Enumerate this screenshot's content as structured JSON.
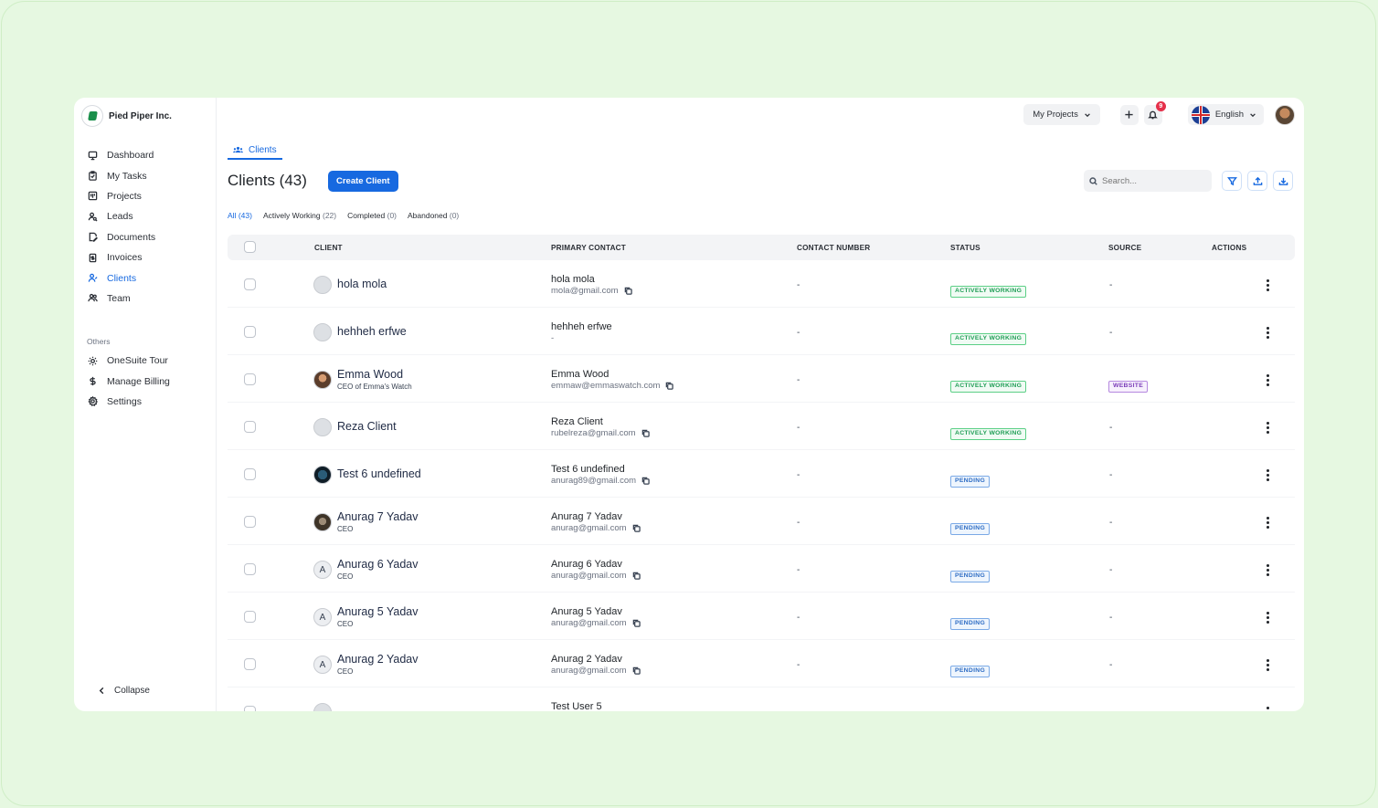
{
  "sidebar": {
    "brand_name": "Pied Piper Inc.",
    "nav": [
      {
        "label": "Dashboard",
        "icon": "monitor-icon"
      },
      {
        "label": "My Tasks",
        "icon": "clipboard-icon"
      },
      {
        "label": "Projects",
        "icon": "kanban-icon"
      },
      {
        "label": "Leads",
        "icon": "user-search-icon"
      },
      {
        "label": "Documents",
        "icon": "document-edit-icon"
      },
      {
        "label": "Invoices",
        "icon": "invoice-icon"
      },
      {
        "label": "Clients",
        "icon": "user-icon",
        "active": true
      },
      {
        "label": "Team",
        "icon": "team-icon"
      }
    ],
    "others_label": "Others",
    "others": [
      {
        "label": "OneSuite Tour",
        "icon": "sun-icon"
      },
      {
        "label": "Manage Billing",
        "icon": "dollar-icon"
      },
      {
        "label": "Settings",
        "icon": "gear-icon"
      }
    ],
    "collapse_label": "Collapse"
  },
  "topbar": {
    "projects_label": "My Projects",
    "notification_count": "9",
    "language": "English"
  },
  "page": {
    "tab_label": "Clients",
    "title": "Clients (43)",
    "create_button": "Create Client",
    "search_placeholder": "Search...",
    "filters": [
      {
        "label": "All",
        "count": "(43)",
        "active": true
      },
      {
        "label": "Actively Working",
        "count": "(22)"
      },
      {
        "label": "Completed",
        "count": "(0)"
      },
      {
        "label": "Abandoned",
        "count": "(0)"
      }
    ]
  },
  "table": {
    "headers": {
      "client": "CLIENT",
      "primary_contact": "PRIMARY CONTACT",
      "contact_number": "CONTACT NUMBER",
      "status": "STATUS",
      "source": "SOURCE",
      "actions": "ACTIONS"
    },
    "rows": [
      {
        "name": "hola mola",
        "sub": "",
        "avatar": "blank",
        "contact_name": "hola mola",
        "contact_email": "mola@gmail.com",
        "copy": true,
        "number": "-",
        "status": "ACTIVELY WORKING",
        "status_color": "green",
        "source": "-"
      },
      {
        "name": "hehheh erfwe",
        "sub": "",
        "avatar": "blank",
        "contact_name": "hehheh erfwe",
        "contact_email": "-",
        "copy": false,
        "number": "-",
        "status": "ACTIVELY WORKING",
        "status_color": "green",
        "source": "-"
      },
      {
        "name": "Emma Wood",
        "sub": "CEO of Emma's Watch",
        "avatar": "photo1",
        "contact_name": "Emma Wood",
        "contact_email": "emmaw@emmaswatch.com",
        "copy": true,
        "number": "-",
        "status": "ACTIVELY WORKING",
        "status_color": "green",
        "source": "WEBSITE"
      },
      {
        "name": "Reza Client",
        "sub": "",
        "avatar": "blank",
        "contact_name": "Reza Client",
        "contact_email": "rubelreza@gmail.com",
        "copy": true,
        "number": "-",
        "status": "ACTIVELY WORKING",
        "status_color": "green",
        "source": "-"
      },
      {
        "name": "Test 6 undefined",
        "sub": "",
        "avatar": "photo2",
        "contact_name": "Test 6 undefined",
        "contact_email": "anurag89@gmail.com",
        "copy": true,
        "number": "-",
        "status": "PENDING",
        "status_color": "blue",
        "source": "-"
      },
      {
        "name": "Anurag 7 Yadav",
        "sub": "CEO",
        "avatar": "photo3",
        "contact_name": "Anurag 7 Yadav",
        "contact_email": "anurag@gmail.com",
        "copy": true,
        "number": "-",
        "status": "PENDING",
        "status_color": "blue",
        "source": "-"
      },
      {
        "name": "Anurag 6 Yadav",
        "sub": "CEO",
        "avatar": "A",
        "contact_name": "Anurag 6 Yadav",
        "contact_email": "anurag@gmail.com",
        "copy": true,
        "number": "-",
        "status": "PENDING",
        "status_color": "blue",
        "source": "-"
      },
      {
        "name": "Anurag 5 Yadav",
        "sub": "CEO",
        "avatar": "A",
        "contact_name": "Anurag 5 Yadav",
        "contact_email": "anurag@gmail.com",
        "copy": true,
        "number": "-",
        "status": "PENDING",
        "status_color": "blue",
        "source": "-"
      },
      {
        "name": "Anurag 2 Yadav",
        "sub": "CEO",
        "avatar": "A",
        "contact_name": "Anurag 2 Yadav",
        "contact_email": "anurag@gmail.com",
        "copy": true,
        "number": "-",
        "status": "PENDING",
        "status_color": "blue",
        "source": "-"
      },
      {
        "name": "",
        "sub": "",
        "avatar": "blank",
        "contact_name": "Test User 5",
        "contact_email": "",
        "copy": false,
        "number": "-",
        "status": "",
        "status_color": "blue",
        "source": "-"
      }
    ]
  },
  "colors": {
    "accent": "#1769e0",
    "background": "#e6f8e1",
    "active_green": "#1f9d55",
    "pending_blue": "#2d6cc4",
    "website_purple": "#7a3bb8",
    "badge_red": "#e5304a"
  }
}
